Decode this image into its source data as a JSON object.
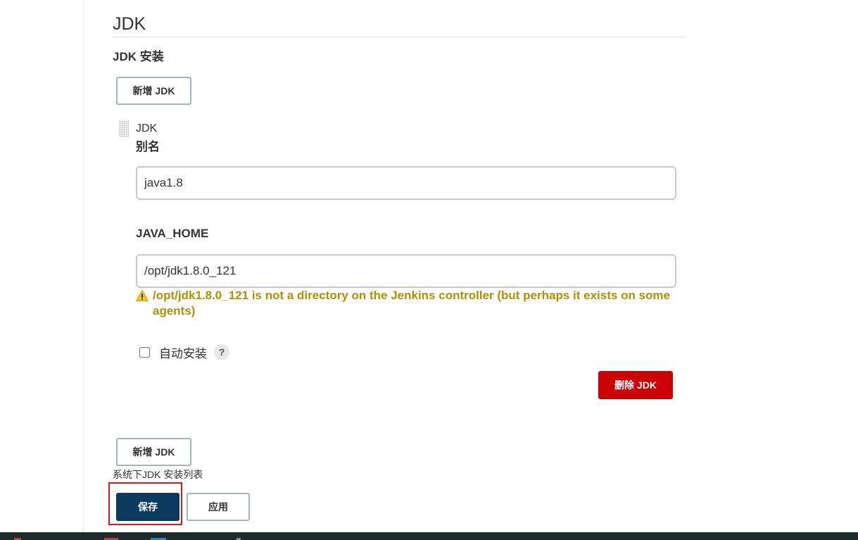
{
  "section": {
    "title": "JDK"
  },
  "installations": {
    "title": "JDK 安装",
    "add_button_label": "新增 JDK",
    "item": {
      "type_label": "JDK",
      "name_label": "别名",
      "name_value": "java1.8",
      "java_home_label": "JAVA_HOME",
      "java_home_value": "/opt/jdk1.8.0_121",
      "warning_text": "/opt/jdk1.8.0_121 is not a directory on the Jenkins controller (but perhaps it exists on some agents)",
      "auto_install_label": "自动安装",
      "auto_install_checked": false,
      "help_icon_text": "?",
      "delete_button_label": "删除 JDK"
    },
    "description": "系统下JDK 安装列表"
  },
  "actions": {
    "save_label": "保存",
    "apply_label": "应用"
  },
  "colors": {
    "warning": "#b29100",
    "danger": "#cc0003",
    "primary": "#0b3a5e",
    "highlight": "#e3161c"
  },
  "icons": {
    "warning": "warning-triangle-icon",
    "help": "help-icon",
    "drag": "drag-handle-icon"
  }
}
